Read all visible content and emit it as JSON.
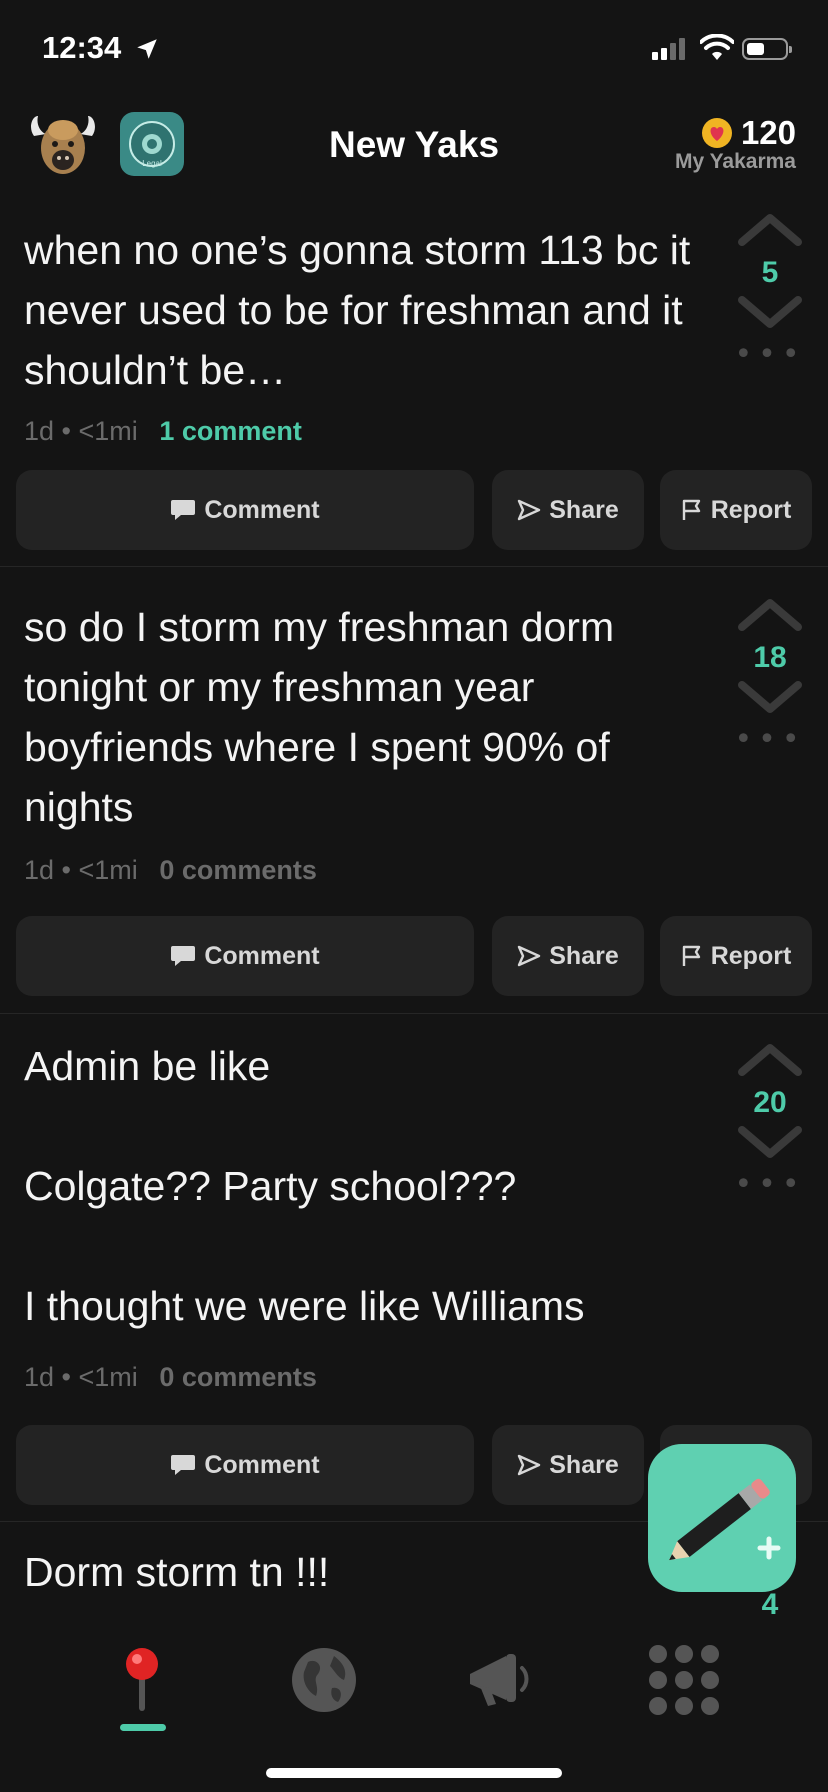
{
  "status": {
    "time": "12:34"
  },
  "header": {
    "title": "New Yaks",
    "karma_value": "120",
    "karma_label": "My Yakarma",
    "badge_text": "Legal"
  },
  "posts": [
    {
      "text": "when no one’s gonna storm 113 bc it never used to be for freshman and it shouldn’t be…",
      "age": "1d",
      "distance": "<1mi",
      "comments": "1 comment",
      "votes": "5"
    },
    {
      "text": "so do I storm my freshman dorm tonight or my freshman year boyfriends where I spent 90% of nights",
      "age": "1d",
      "distance": "<1mi",
      "comments": "0 comments",
      "votes": "18"
    },
    {
      "text": "Admin be like\n\nColgate?? Party school???\n\nI thought we were like Williams",
      "age": "1d",
      "distance": "<1mi",
      "comments": "0 comments",
      "votes": "20"
    },
    {
      "text": "Dorm storm tn !!!",
      "votes": "4"
    }
  ],
  "actions": {
    "comment": "Comment",
    "share": "Share",
    "report": "Report"
  },
  "icons": {
    "avatar": "yak-avatar",
    "badge": "school-badge",
    "karma": "heart-icon",
    "tabs": [
      "pin-icon",
      "globe-icon",
      "megaphone-icon",
      "grid-icon"
    ],
    "fab": "pencil-plus-icon"
  },
  "colors": {
    "accent": "#4ecba9",
    "fab": "#5fd0b1",
    "background": "#141414",
    "button": "#232323"
  }
}
